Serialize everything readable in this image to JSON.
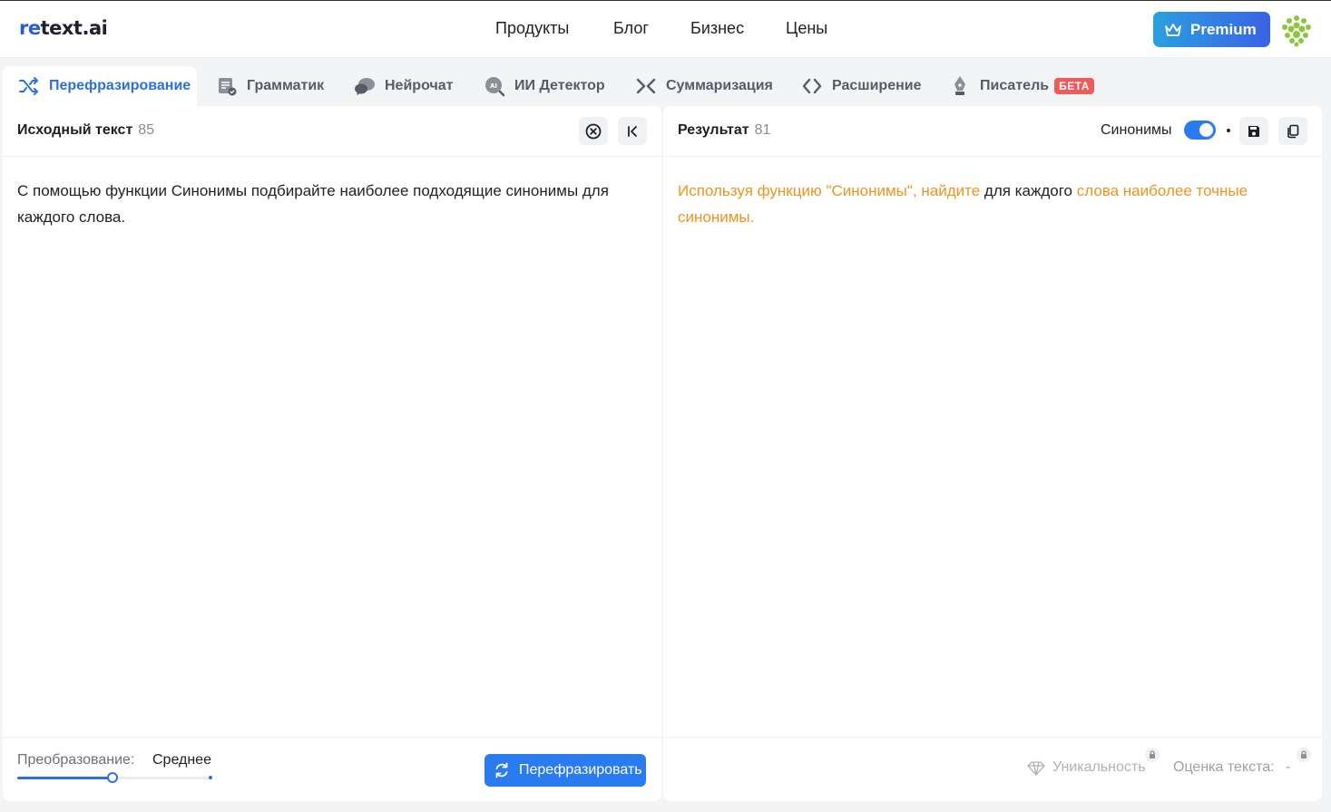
{
  "header": {
    "logo_prefix": "re",
    "logo_suffix": "text.ai",
    "nav": [
      "Продукты",
      "Блог",
      "Бизнес",
      "Цены"
    ],
    "premium_label": "Premium",
    "accent_color": "#2b7bf0"
  },
  "tabs": [
    {
      "label": "Перефразирование",
      "icon": "shuffle-icon",
      "active": true
    },
    {
      "label": "Грамматик",
      "icon": "document-check-icon"
    },
    {
      "label": "Нейрочат",
      "icon": "chat-icon"
    },
    {
      "label": "ИИ Детектор",
      "icon": "ai-search-icon"
    },
    {
      "label": "Суммаризация",
      "icon": "compress-icon"
    },
    {
      "label": "Расширение",
      "icon": "expand-icon"
    },
    {
      "label": "Писатель",
      "icon": "pen-nib-icon",
      "badge": "БЕТА"
    }
  ],
  "source": {
    "title": "Исходный текст",
    "count": "85",
    "text": "С помощью функции Синонимы подбирайте наиболее подходящие синонимы для каждого слова.",
    "transform_label": "Преобразование:",
    "transform_value": "Среднее",
    "transform_level_percent": 49,
    "action_label": "Перефразировать"
  },
  "result": {
    "title": "Результат",
    "count": "81",
    "synonyms_label": "Синонимы",
    "synonyms_on": true,
    "segments": [
      {
        "text": "Используя функцию \"Синонимы\", найдите",
        "changed": true
      },
      {
        "text": " для каждого ",
        "changed": false
      },
      {
        "text": "слова наиболее точные синонимы.",
        "changed": true
      }
    ],
    "uniqueness_label": "Уникальность",
    "score_label": "Оценка текста:",
    "score_value": "-",
    "highlight_color": "#f0921e"
  }
}
